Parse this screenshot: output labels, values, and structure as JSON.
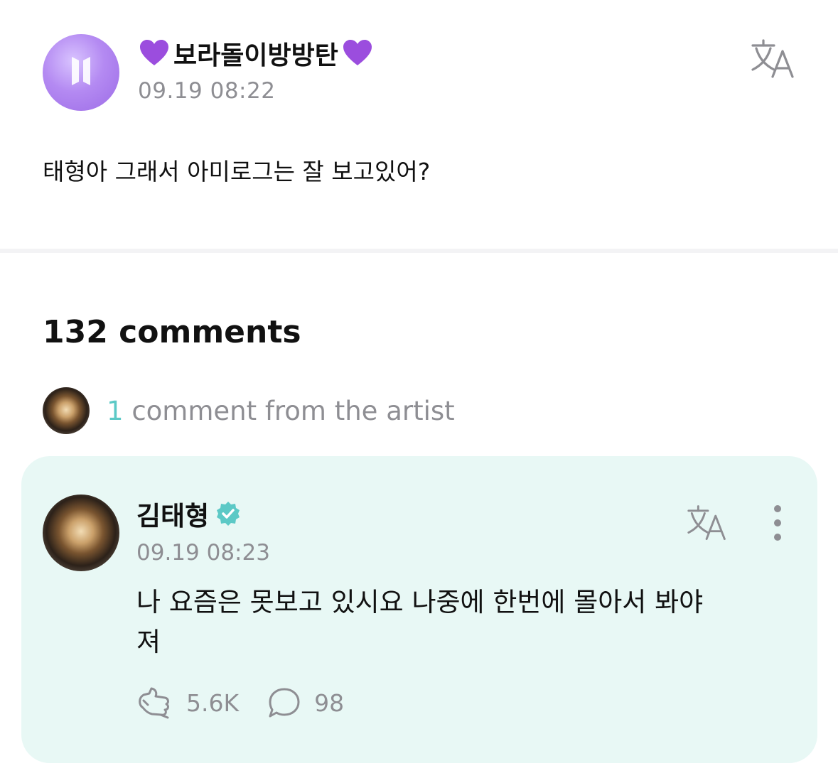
{
  "post": {
    "author_prefix_emoji": "purple-heart",
    "author_name": "보라돌이방방탄",
    "author_suffix_emoji": "purple-heart",
    "timestamp": "09.19 08:22",
    "body": "태형아 그래서 아미로그는 잘 보고있어?",
    "translate_icon": "translate-icon"
  },
  "comments": {
    "count_label": "132 comments",
    "artist_count": "1",
    "artist_label": "comment from the artist"
  },
  "artist_comment": {
    "author": "김태형",
    "verified_icon": "verified-badge-icon",
    "timestamp": "09.19 08:23",
    "body_line1": "나 요즘은 못보고 있시요 나중에 한번에 몰아서 봐야",
    "body_line2": "져",
    "likes": "5.6K",
    "replies": "98"
  },
  "colors": {
    "accent_teal": "#5cc9c6",
    "card_bg": "#e8f8f5",
    "muted_text": "#8e8e93",
    "heart_purple": "#9b4dde"
  }
}
